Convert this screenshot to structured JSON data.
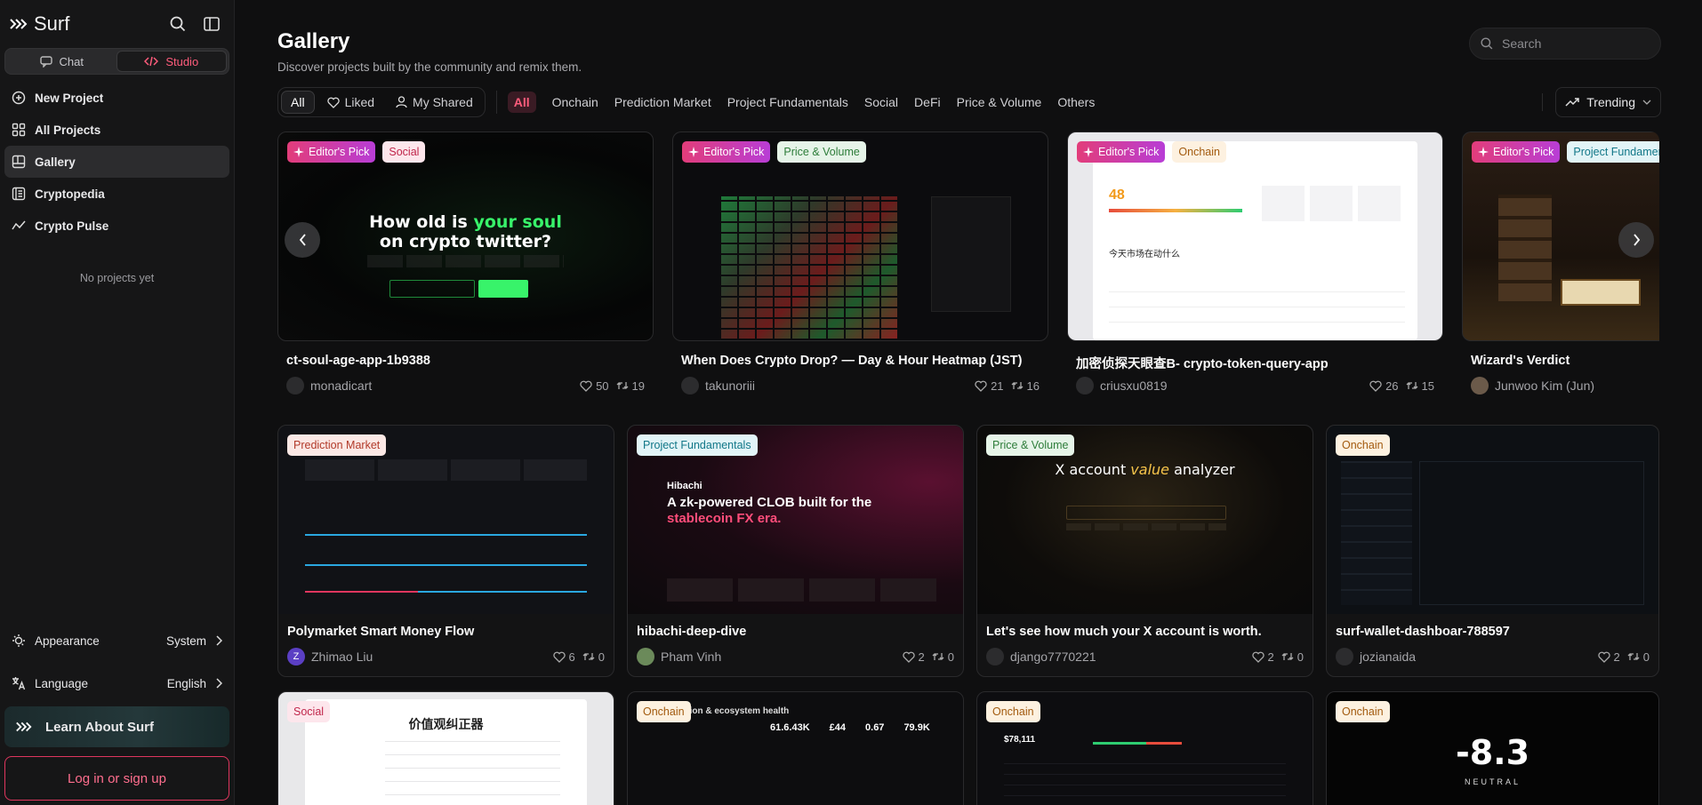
{
  "brand": {
    "name": "Surf"
  },
  "mode_toggle": {
    "chat": "Chat",
    "studio": "Studio"
  },
  "nav": [
    {
      "label": "New Project",
      "icon": "plus-circle-icon"
    },
    {
      "label": "All Projects",
      "icon": "grid-icon"
    },
    {
      "label": "Gallery",
      "icon": "gallery-icon"
    },
    {
      "label": "Cryptopedia",
      "icon": "book-icon"
    },
    {
      "label": "Crypto Pulse",
      "icon": "pulse-icon"
    }
  ],
  "sidebar": {
    "empty": "No projects yet",
    "appearance_label": "Appearance",
    "appearance_value": "System",
    "language_label": "Language",
    "language_value": "English",
    "learn": "Learn About Surf",
    "login": "Log in or sign up"
  },
  "header": {
    "title": "Gallery",
    "subtitle": "Discover projects built by the community and remix them.",
    "search_placeholder": "Search"
  },
  "filters": {
    "scope": [
      "All",
      "Liked",
      "My Shared"
    ],
    "categories": [
      "All",
      "Onchain",
      "Prediction Market",
      "Project Fundamentals",
      "Social",
      "DeFi",
      "Price & Volume",
      "Others"
    ],
    "sort": "Trending"
  },
  "featured": [
    {
      "tags": [
        "Editor's Pick",
        "Social"
      ],
      "title": "ct-soul-age-app-1b9388",
      "author": "monadicart",
      "likes": "50",
      "remixes": "19",
      "thumb": {
        "line1": "How old is ",
        "accent": "your soul",
        "line2": "on crypto twitter?"
      }
    },
    {
      "tags": [
        "Editor's Pick",
        "Price & Volume"
      ],
      "title": "When Does Crypto Drop? — Day & Hour Heatmap (JST)",
      "author": "takunoriii",
      "likes": "21",
      "remixes": "16"
    },
    {
      "tags": [
        "Editor's Pick",
        "Onchain"
      ],
      "title": "加密侦探天眼查B- crypto-token-query-app",
      "author": "criusxu0819",
      "likes": "26",
      "remixes": "15",
      "thumb": {
        "score": "48",
        "caption": "今天市场在动什么"
      }
    },
    {
      "tags": [
        "Editor's Pick",
        "Project Fundamentals"
      ],
      "title": "Wizard's Verdict",
      "author": "Junwoo Kim (Jun)",
      "likes": "",
      "remixes": ""
    }
  ],
  "grid": [
    {
      "tag": "Prediction Market",
      "title": "Polymarket Smart Money Flow",
      "author": "Zhimao Liu",
      "avatar": "Z",
      "likes": "6",
      "remixes": "0"
    },
    {
      "tag": "Project Fundamentals",
      "title": "hibachi-deep-dive",
      "author": "Pham Vinh",
      "avatar": "",
      "likes": "2",
      "remixes": "0",
      "thumb": {
        "brand": "Hibachi",
        "headline": "A zk-powered CLOB built for the",
        "accent": "stablecoin FX era."
      }
    },
    {
      "tag": "Price & Volume",
      "title": "Let's see how much your X account is worth.",
      "author": "django7770221",
      "avatar": "",
      "likes": "2",
      "remixes": "0",
      "thumb": {
        "text": "X account ",
        "accent": "value",
        "text2": " analyzer"
      }
    },
    {
      "tag": "Onchain",
      "title": "surf-wallet-dashboar-788597",
      "author": "jozianaida",
      "avatar": "",
      "likes": "2",
      "remixes": "0"
    }
  ],
  "bottom": [
    {
      "tag": "Social",
      "thumb": {
        "title": "价值观纠正器"
      }
    },
    {
      "tag": "Onchain",
      "thumb": {
        "title": "Participation & ecosystem health",
        "stats": [
          "61.6.43K",
          "£44",
          "0.67",
          "79.9K"
        ]
      }
    },
    {
      "tag": "Onchain",
      "thumb": {
        "stat": "$78,111"
      }
    },
    {
      "tag": "Onchain",
      "thumb": {
        "value": "-8.3",
        "label": "NEUTRAL"
      }
    }
  ],
  "colors": {
    "accent": "#ff5c7c",
    "bg": "#0f0f10",
    "sidebar": "#161617"
  }
}
